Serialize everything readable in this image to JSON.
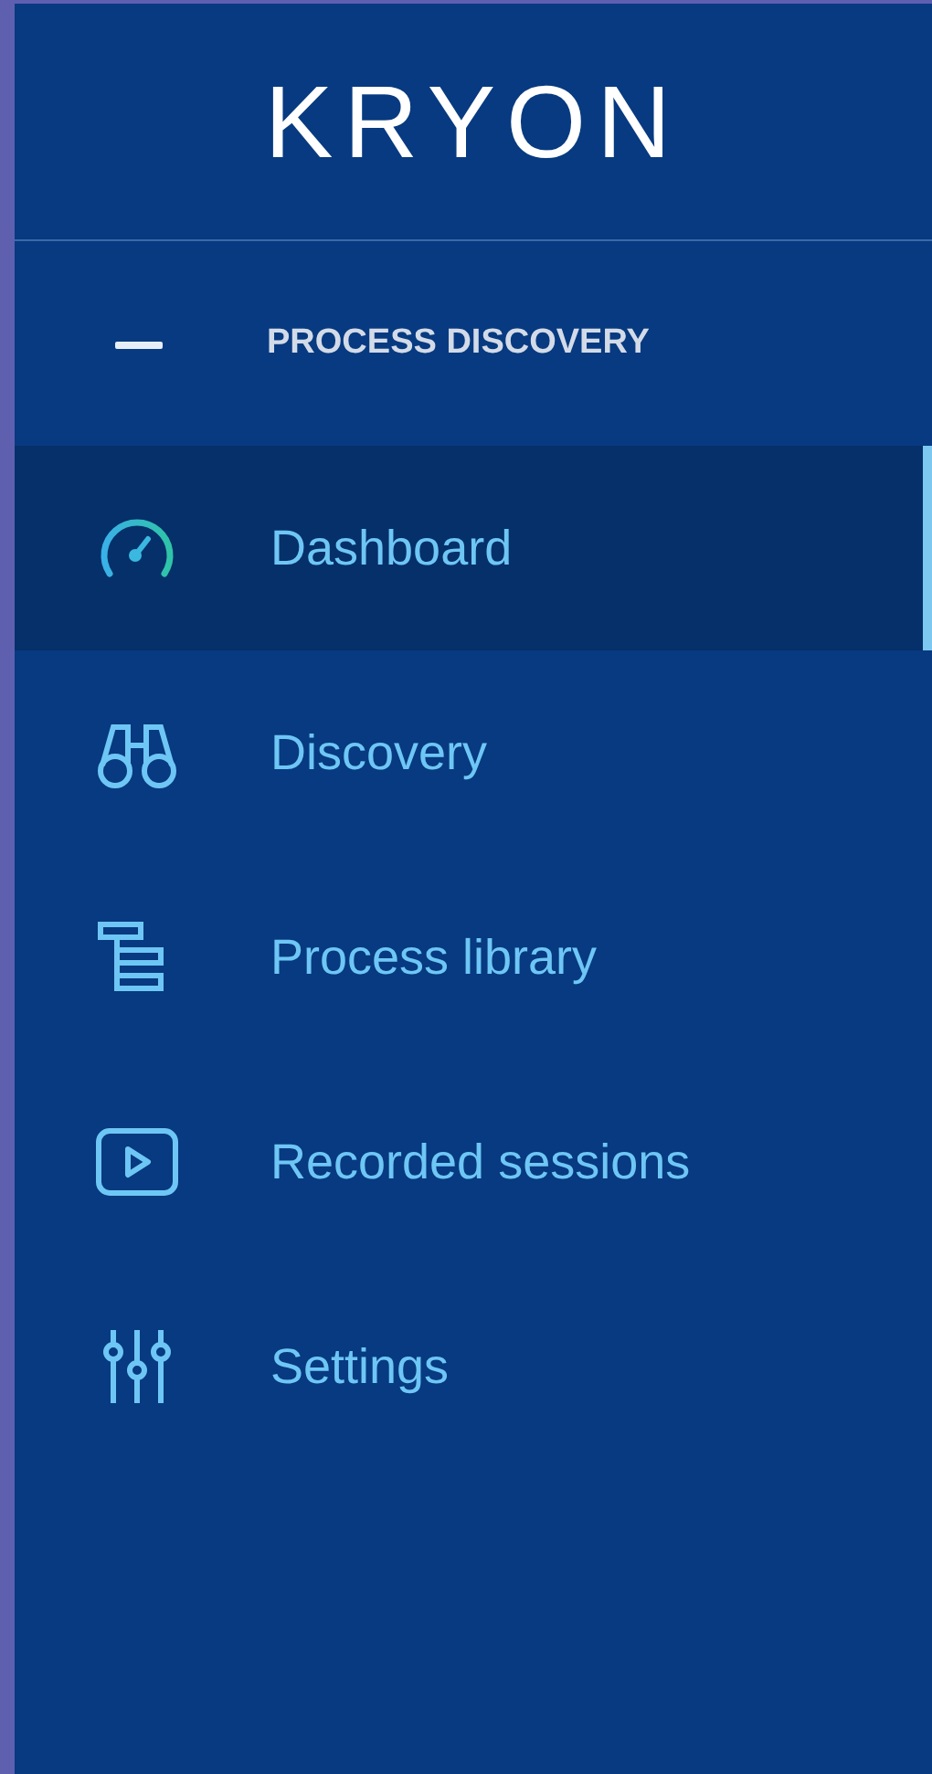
{
  "logo": "KRYON",
  "section": {
    "title": "PROCESS DISCOVERY",
    "expanded": true
  },
  "items": [
    {
      "label": "Dashboard",
      "selected": true
    },
    {
      "label": "Discovery",
      "selected": false
    },
    {
      "label": "Process library",
      "selected": false
    },
    {
      "label": "Recorded sessions",
      "selected": false
    },
    {
      "label": "Settings",
      "selected": false
    }
  ]
}
